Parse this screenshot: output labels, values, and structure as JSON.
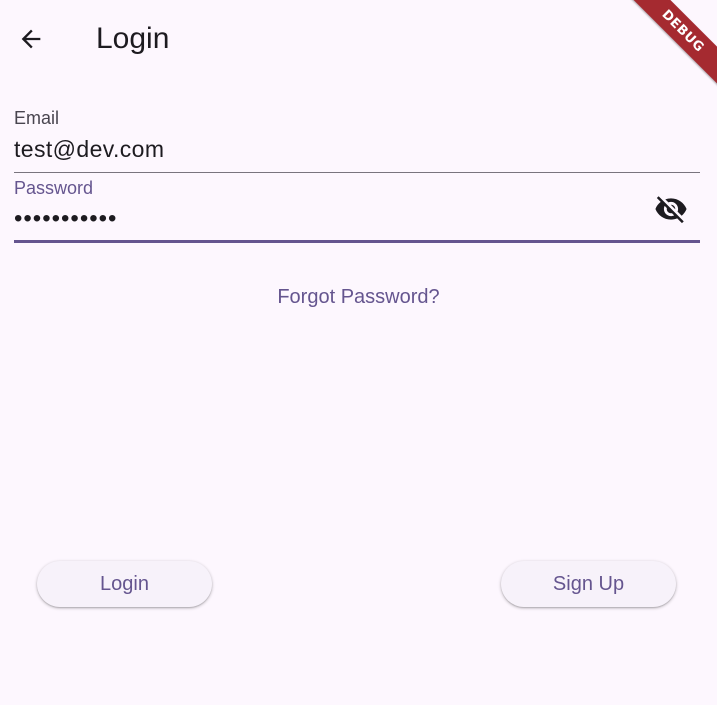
{
  "appbar": {
    "title": "Login",
    "back_icon": "arrow-back-icon"
  },
  "debug_banner": {
    "label": "DEBUG",
    "color": "#a52a30"
  },
  "form": {
    "email": {
      "label": "Email",
      "value": "test@dev.com"
    },
    "password": {
      "label": "Password",
      "value": "•••••••••••",
      "toggle_icon": "visibility-off-icon"
    },
    "forgot_password": "Forgot Password?"
  },
  "actions": {
    "login_label": "Login",
    "signup_label": "Sign Up"
  },
  "colors": {
    "background": "#fdf7fe",
    "primary": "#65558f",
    "text": "#1d1b20",
    "label": "#49454f",
    "button_surface": "#f7f2fa"
  }
}
